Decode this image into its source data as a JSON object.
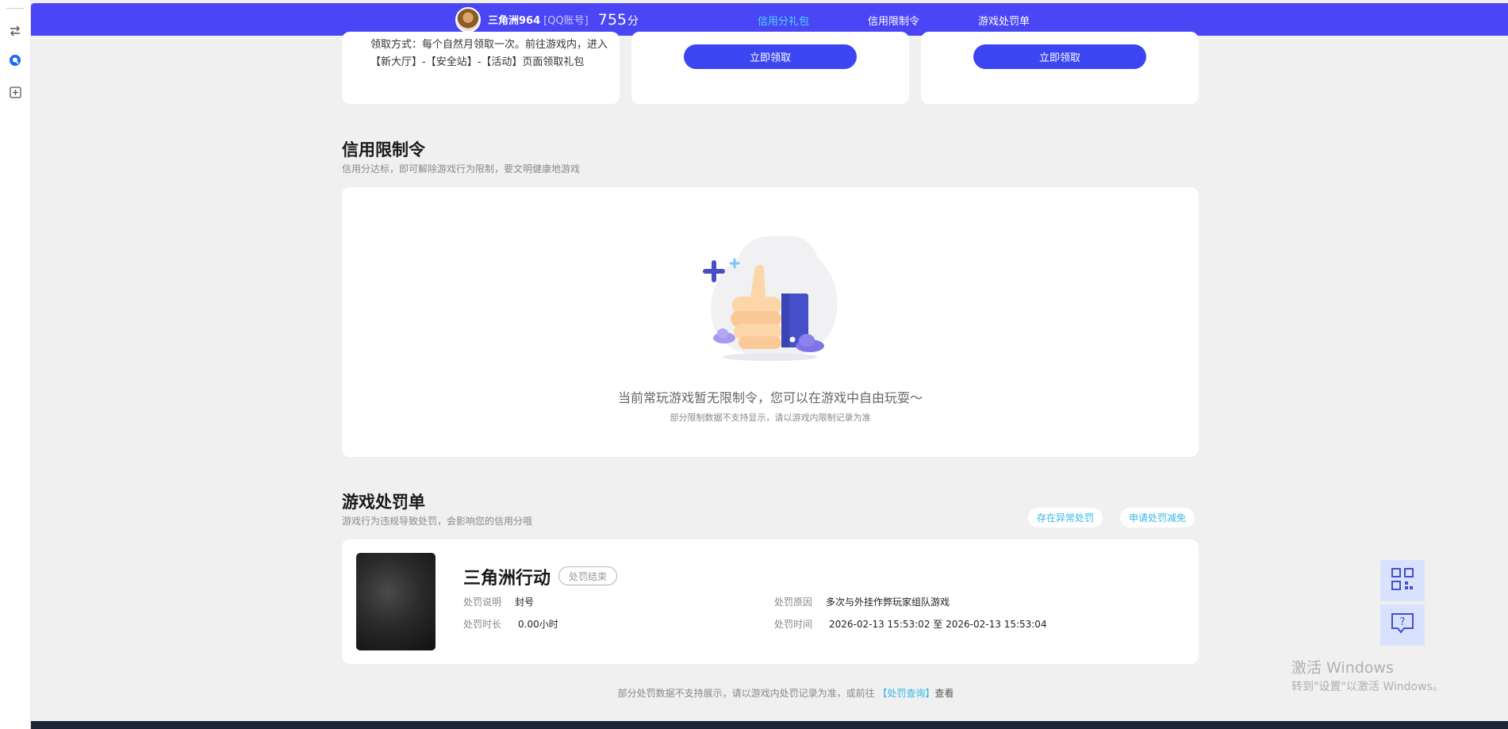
{
  "user": {
    "name": "三角洲964",
    "account_type": "[QQ账号]",
    "score": "755",
    "score_unit": "分"
  },
  "nav": {
    "tabs": [
      {
        "label": "信用分礼包",
        "active": true
      },
      {
        "label": "信用限制令",
        "active": false
      },
      {
        "label": "游戏处罚单",
        "active": false
      }
    ]
  },
  "gifts": {
    "claim_method": "领取方式：每个自然月领取一次。前往游戏内，进入【新大厅】-【安全站】-【活动】页面领取礼包",
    "buttons": [
      "立即领取",
      "立即领取"
    ]
  },
  "restriction": {
    "title": "信用限制令",
    "subtitle": "信用分达标，即可解除游戏行为限制，要文明健康地游戏",
    "empty_message": "当前常玩游戏暂无限制令，您可以在游戏中自由玩耍～",
    "empty_note": "部分限制数据不支持显示，请以游戏内限制记录为准"
  },
  "penalty": {
    "title": "游戏处罚单",
    "subtitle": "游戏行为违规导致处罚，会影响您的信用分哦",
    "actions": [
      "存在异常处罚",
      "申请处罚减免"
    ],
    "record": {
      "game": "三角洲行动",
      "status": "处罚结束",
      "desc_label": "处罚说明",
      "desc_value": "封号",
      "duration_label": "处罚时长",
      "duration_value": "0.00小时",
      "reason_label": "处罚原因",
      "reason_value": "多次与外挂作弊玩家组队游戏",
      "time_label": "处罚时间",
      "time_start": "2026-02-13 15:53:02",
      "time_sep": "至",
      "time_end": "2026-02-13 15:53:04"
    },
    "footnote_prefix": "部分处罚数据不支持展示，请以游戏内处罚记录为准，或前往",
    "footnote_link": "【处罚查询】",
    "footnote_suffix": "查看"
  },
  "watermark": {
    "line1": "激活 Windows",
    "line2": "转到\"设置\"以激活 Windows。"
  },
  "colors": {
    "brand": "#4a45f5",
    "button": "#3b46f2",
    "active_tab": "#4ad8ff",
    "link": "#36b8e8"
  },
  "icons": [
    "swap-icon",
    "qq-icon",
    "add-icon",
    "qr-code-icon",
    "feedback-icon"
  ]
}
